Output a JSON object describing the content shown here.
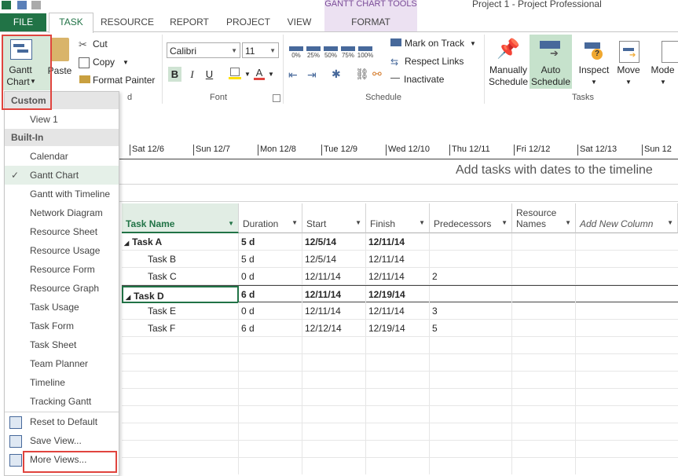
{
  "window": {
    "title": "Project 1 - Project Professional"
  },
  "tabs": {
    "file": "FILE",
    "task": "TASK",
    "resource": "RESOURCE",
    "report": "REPORT",
    "project": "PROJECT",
    "view": "VIEW",
    "contextual_group": "GANTT CHART TOOLS",
    "format": "FORMAT"
  },
  "ribbon": {
    "view": {
      "gantt_line1": "Gantt",
      "gantt_line2": "Chart"
    },
    "clipboard": {
      "paste": "Paste",
      "cut": "Cut",
      "copy": "Copy",
      "format_painter": "Format Painter",
      "group": "d"
    },
    "font": {
      "family": "Calibri",
      "size": "11",
      "bold": "B",
      "italic": "I",
      "underline": "U",
      "group": "Font"
    },
    "schedule": {
      "pct": [
        "0%",
        "25%",
        "50%",
        "75%",
        "100%"
      ],
      "mark_on_track": "Mark on Track",
      "respect_links": "Respect Links",
      "inactivate": "Inactivate",
      "group": "Schedule"
    },
    "tasks": {
      "manually_1": "Manually",
      "manually_2": "Schedule",
      "auto_1": "Auto",
      "auto_2": "Schedule",
      "inspect": "Inspect",
      "move": "Move",
      "mode": "Mode",
      "group": "Tasks"
    }
  },
  "timeline": {
    "dates": [
      "Sat 12/6",
      "Sun 12/7",
      "Mon 12/8",
      "Tue 12/9",
      "Wed 12/10",
      "Thu 12/11",
      "Fri 12/12",
      "Sat 12/13",
      "Sun 12"
    ],
    "hint": "Add tasks with dates to the timeline"
  },
  "menu": {
    "custom_header": "Custom",
    "custom_items": [
      "View 1"
    ],
    "builtin_header": "Built-In",
    "builtin_items": [
      "Calendar",
      "Gantt Chart",
      "Gantt with Timeline",
      "Network Diagram",
      "Resource Sheet",
      "Resource Usage",
      "Resource Form",
      "Resource Graph",
      "Task Usage",
      "Task Form",
      "Task Sheet",
      "Team Planner",
      "Timeline",
      "Tracking Gantt"
    ],
    "checked_item": "Gantt Chart",
    "reset": "Reset to Default",
    "save_view": "Save View...",
    "more_views": "More Views..."
  },
  "grid": {
    "columns": [
      "Task Name",
      "Duration",
      "Start",
      "Finish",
      "Predecessors",
      "Resource Names",
      "Add New Column"
    ],
    "rows": [
      {
        "name": "Task A",
        "duration": "5 d",
        "start": "12/5/14",
        "finish": "12/11/14",
        "pred": "",
        "summary": true
      },
      {
        "name": "Task B",
        "duration": "5 d",
        "start": "12/5/14",
        "finish": "12/11/14",
        "pred": "",
        "summary": false
      },
      {
        "name": "Task C",
        "duration": "0 d",
        "start": "12/11/14",
        "finish": "12/11/14",
        "pred": "2",
        "summary": false
      },
      {
        "name": "Task D",
        "duration": "6 d",
        "start": "12/11/14",
        "finish": "12/19/14",
        "pred": "",
        "summary": true
      },
      {
        "name": "Task E",
        "duration": "0 d",
        "start": "12/11/14",
        "finish": "12/11/14",
        "pred": "3",
        "summary": false
      },
      {
        "name": "Task F",
        "duration": "6 d",
        "start": "12/12/14",
        "finish": "12/19/14",
        "pred": "5",
        "summary": false
      }
    ]
  },
  "colors": {
    "file_tab": "#217346",
    "accent": "#217346",
    "highlight": "#e0443e",
    "contextual": "#ece1f2"
  }
}
